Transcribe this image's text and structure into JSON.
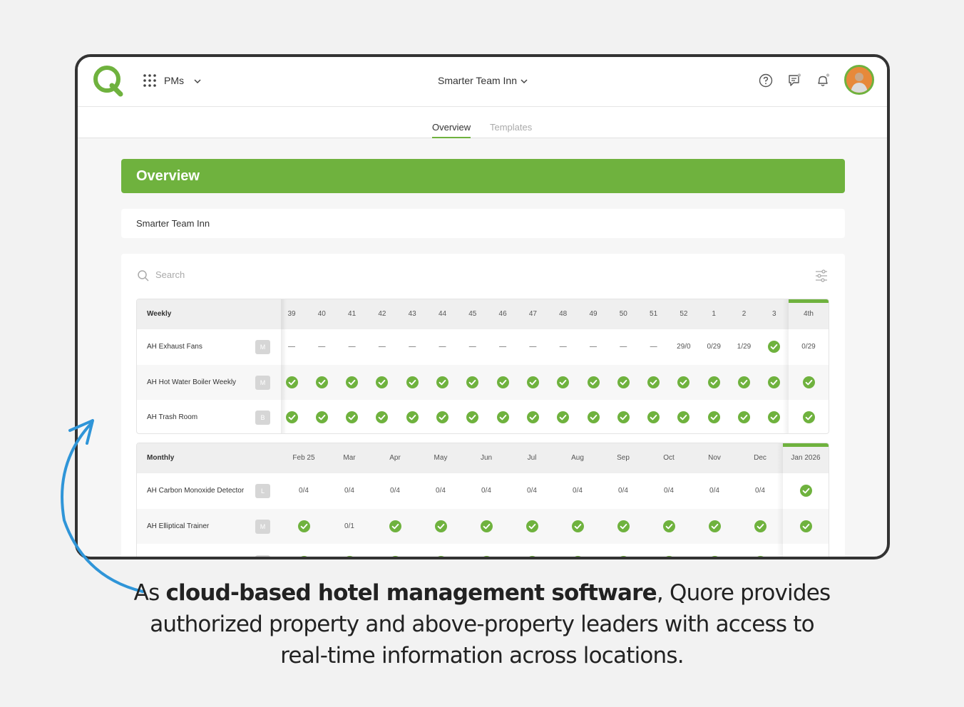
{
  "header": {
    "module": "PMs",
    "property": "Smarter Team Inn"
  },
  "tabs": [
    {
      "label": "Overview",
      "active": true
    },
    {
      "label": "Templates",
      "active": false
    }
  ],
  "page_title": "Overview",
  "property_name": "Smarter Team Inn",
  "search": {
    "placeholder": "Search"
  },
  "weekly": {
    "title": "Weekly",
    "columns": [
      "39",
      "40",
      "41",
      "42",
      "43",
      "44",
      "45",
      "46",
      "47",
      "48",
      "49",
      "50",
      "51",
      "52",
      "1",
      "2",
      "3",
      "4th"
    ],
    "rows": [
      {
        "name": "AH Exhaust Fans",
        "badge": "M",
        "cells": [
          "—",
          "—",
          "—",
          "—",
          "—",
          "—",
          "—",
          "—",
          "—",
          "—",
          "—",
          "—",
          "—",
          "29/0",
          "0/29",
          "1/29",
          "check",
          "0/29"
        ]
      },
      {
        "name": "AH Hot Water Boiler Weekly",
        "badge": "M",
        "cells": [
          "check",
          "check",
          "check",
          "check",
          "check",
          "check",
          "check",
          "check",
          "check",
          "check",
          "check",
          "check",
          "check",
          "check",
          "check",
          "check",
          "check",
          "check"
        ]
      },
      {
        "name": "AH Trash Room",
        "badge": "B",
        "cells": [
          "check",
          "check",
          "check",
          "check",
          "check",
          "check",
          "check",
          "check",
          "check",
          "check",
          "check",
          "check",
          "check",
          "check",
          "check",
          "check",
          "check",
          "check"
        ]
      }
    ]
  },
  "monthly": {
    "title": "Monthly",
    "columns": [
      "Feb 25",
      "Mar",
      "Apr",
      "May",
      "Jun",
      "Jul",
      "Aug",
      "Sep",
      "Oct",
      "Nov",
      "Dec",
      "Jan 2026"
    ],
    "rows": [
      {
        "name": "AH Carbon Monoxide Detector",
        "badge": "L",
        "cells": [
          "0/4",
          "0/4",
          "0/4",
          "0/4",
          "0/4",
          "0/4",
          "0/4",
          "0/4",
          "0/4",
          "0/4",
          "0/4",
          "check"
        ]
      },
      {
        "name": "AH Elliptical Trainer",
        "badge": "M",
        "cells": [
          "check",
          "0/1",
          "check",
          "check",
          "check",
          "check",
          "check",
          "check",
          "check",
          "check",
          "check",
          "check"
        ]
      },
      {
        "name": "",
        "badge": "",
        "cells": [
          "check",
          "check",
          "check",
          "check",
          "check",
          "check",
          "check",
          "check",
          "check",
          "check",
          "check",
          ""
        ]
      }
    ]
  },
  "caption": {
    "prefix": "As ",
    "bold": "cloud-based hotel management software",
    "suffix": ", Quore provides authorized property and above-property leaders with access to real-time information across locations."
  },
  "colors": {
    "accent": "#6fb23e",
    "arrow": "#2f95d8"
  },
  "icons": [
    "quore-logo-icon",
    "app-grid-icon",
    "chevron-down-icon",
    "help-icon",
    "chat-icon",
    "bell-icon",
    "search-icon",
    "filter-icon",
    "check-icon"
  ]
}
